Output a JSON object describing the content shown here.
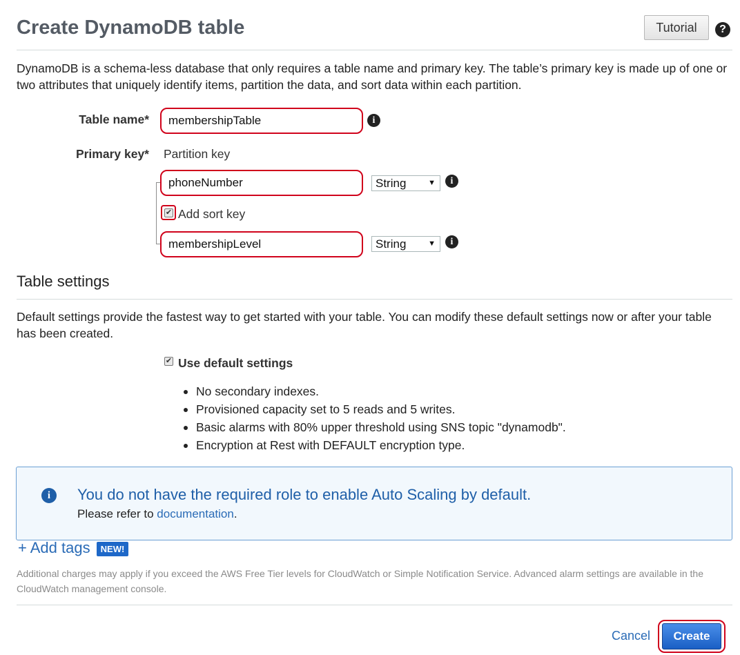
{
  "header": {
    "title": "Create DynamoDB table",
    "tutorial_label": "Tutorial",
    "help_glyph": "?"
  },
  "intro": "DynamoDB is a schema-less database that only requires a table name and primary key. The table’s primary key is made up of one or two attributes that uniquely identify items, partition the data, and sort data within each partition.",
  "form": {
    "table_name_label": "Table name*",
    "table_name_value": "membershipTable",
    "primary_key_label": "Primary key*",
    "partition_key_label": "Partition key",
    "partition_key_value": "phoneNumber",
    "partition_key_type": "String",
    "add_sort_key_label": "Add sort key",
    "add_sort_key_checked": true,
    "sort_key_value": "membershipLevel",
    "sort_key_type": "String",
    "info_glyph": "i",
    "select_arrow": "▼"
  },
  "table_settings": {
    "heading": "Table settings",
    "description": "Default settings provide the fastest way to get started with your table. You can modify these default settings now or after your table has been created.",
    "use_default_label": "Use default settings",
    "use_default_checked": true,
    "defaults": [
      "No secondary indexes.",
      "Provisioned capacity set to 5 reads and 5 writes.",
      "Basic alarms with 80% upper threshold using SNS topic \"dynamodb\".",
      "Encryption at Rest with DEFAULT encryption type."
    ]
  },
  "notice": {
    "title": "You do not have the required role to enable Auto Scaling by default.",
    "body_prefix": "Please refer to",
    "link_label": "documentation",
    "body_suffix": ".",
    "icon_glyph": "i"
  },
  "tags": {
    "add_tags_label": "+ Add tags",
    "new_badge": "NEW!"
  },
  "footer_note": "Additional charges may apply if you exceed the AWS Free Tier levels for CloudWatch or Simple Notification Service. Advanced alarm settings are available in the CloudWatch management console.",
  "actions": {
    "cancel_label": "Cancel",
    "create_label": "Create"
  },
  "colors": {
    "accent_blue": "#1f5fa8",
    "highlight_red": "#d0021b",
    "primary_button": "#1a5fc5"
  },
  "icons": {
    "help": "question-circle-icon",
    "info": "info-circle-icon",
    "check": "checkmark-icon"
  }
}
